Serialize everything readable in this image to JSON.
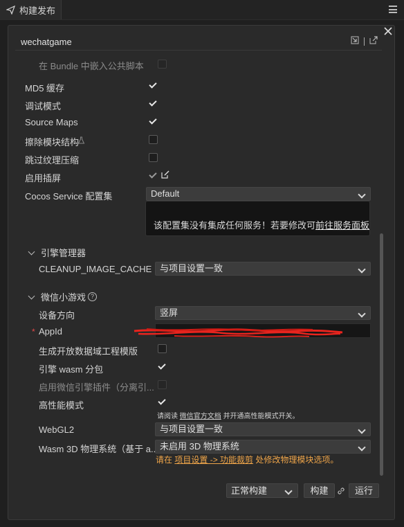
{
  "tab": {
    "title": "构建发布"
  },
  "platform": {
    "title": "wechatgame"
  },
  "rows": {
    "bundle_embed": "在 Bundle 中嵌入公共脚本",
    "md5": "MD5 缓存",
    "debug": "调试模式",
    "source_maps": "Source Maps",
    "erase_modules": "擦除模块结构",
    "skip_texture": "跳过纹理压缩",
    "splash": "启用插屏",
    "cocos_service": "Cocos Service 配置集"
  },
  "cocos_service_select": "Default",
  "info": {
    "text": "该配置集没有集成任何服务！若要修改可",
    "link": "前往服务面板"
  },
  "engine_section": {
    "title": "引擎管理器",
    "cleanup_label": "CLEANUP_IMAGE_CACHE",
    "cleanup_value": "与项目设置一致"
  },
  "wechat_section": {
    "title": "微信小游戏",
    "help": "?",
    "orientation_label": "设备方向",
    "orientation_value": "竖屏",
    "appid_label": "AppId",
    "appid_required": "*",
    "open_data_label": "生成开放数据域工程模版",
    "wasm_label": "引擎 wasm 分包",
    "plugin_label": "启用微信引擎插件（分离引...",
    "high_perf_label": "高性能模式",
    "high_perf_note_prefix": "请阅读",
    "high_perf_note_link": "微信官方文档",
    "high_perf_note_suffix": "并开通高性能模式开关。",
    "webgl2_label": "WebGL2",
    "webgl2_value": "与项目设置一致",
    "wasm3d_label": "Wasm 3D 物理系统（基于 a...",
    "wasm3d_value": "未启用 3D 物理系统",
    "physics_note_prefix": "请在",
    "physics_note_link": "项目设置 -> 功能裁剪",
    "physics_note_suffix": "处修改物理模块选项。"
  },
  "footer": {
    "build_mode": "正常构建",
    "build_button": "构建",
    "run_button": "运行"
  },
  "colors": {
    "warning": "#f0a64a",
    "required": "#e24a4a",
    "redaction": "#e8241e"
  }
}
